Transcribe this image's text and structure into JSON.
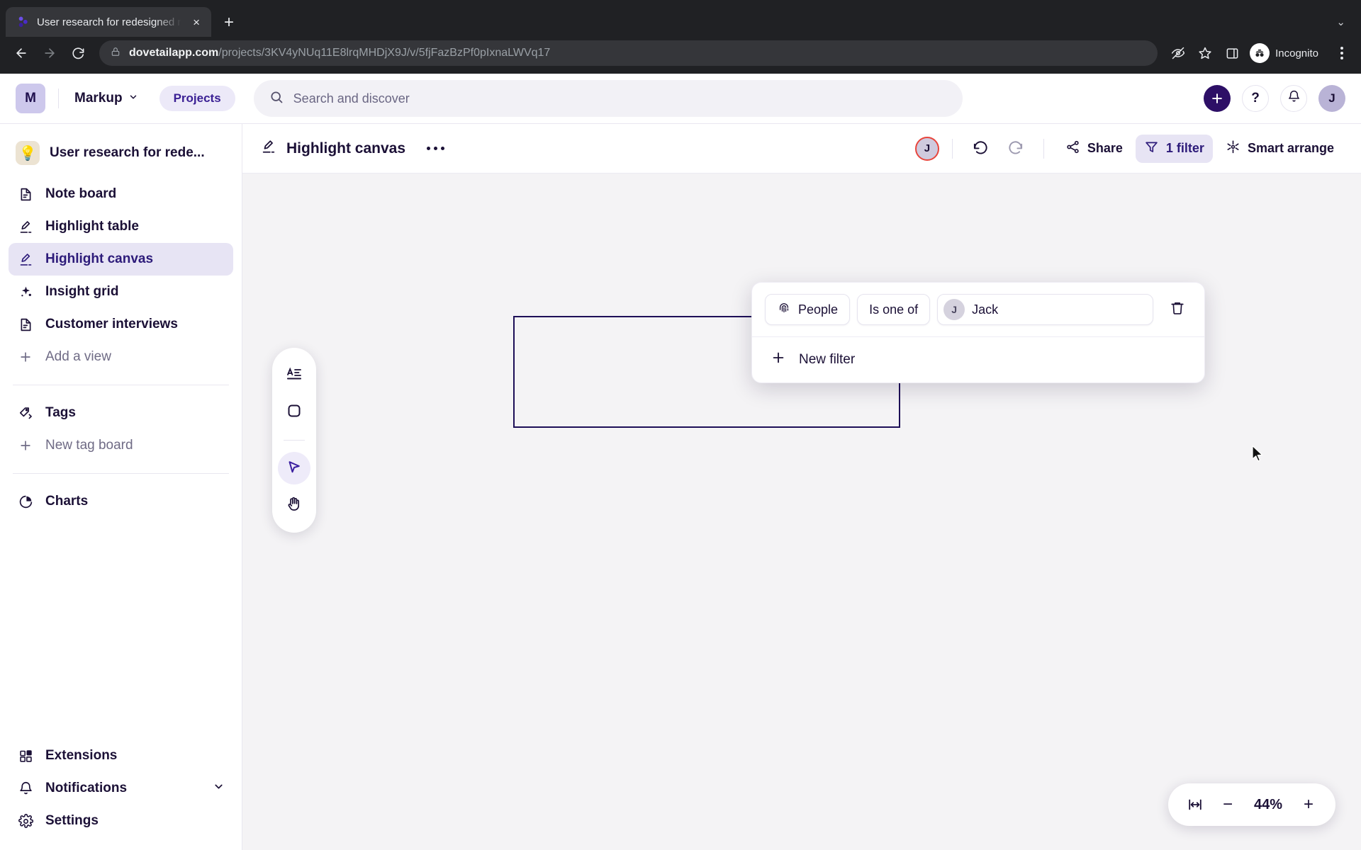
{
  "browser": {
    "tab": {
      "title": "User research for redesigned n",
      "favicon": "dovetail-logo-icon",
      "close": "×"
    },
    "new_tab_label": "+",
    "tab_list_chevron": "⌄",
    "back_icon": "back-arrow-icon",
    "forward_icon": "forward-arrow-icon",
    "reload_icon": "reload-icon",
    "url_domain": "dovetailapp.com",
    "url_path": "/projects/3KV4yNUq11E8lrqMHDjX9J/v/5fjFazBzPf0pIxnaLWVq17",
    "lock_icon": "lock-icon",
    "eye_off_icon": "eye-off-icon",
    "bookmark_icon": "star-icon",
    "side_panel_icon": "side-panel-icon",
    "incognito_label": "Incognito",
    "incognito_icon": "incognito-glasses-icon",
    "menu_icon": "three-dot-menu-icon"
  },
  "appbar": {
    "workspace_initial": "M",
    "workspace_name": "Markup",
    "workspace_chevron": "⌄",
    "projects_label": "Projects",
    "search_placeholder": "Search and discover",
    "search_value": "",
    "search_icon": "search-icon",
    "plus_label": "+",
    "help_label": "?",
    "bell_icon": "bell-icon",
    "avatar_initial": "J"
  },
  "sidebar": {
    "project": {
      "emoji": "💡",
      "name": "User research for rede..."
    },
    "views": [
      {
        "label": "Note board",
        "icon": "document-icon",
        "active": false
      },
      {
        "label": "Highlight table",
        "icon": "highlighter-icon",
        "active": false
      },
      {
        "label": "Highlight canvas",
        "icon": "highlighter-icon",
        "active": true
      },
      {
        "label": "Insight grid",
        "icon": "sparkle-icon",
        "active": false
      },
      {
        "label": "Customer interviews",
        "icon": "document-icon",
        "active": false
      }
    ],
    "add_view": {
      "label": "Add a view",
      "icon": "plus-icon"
    },
    "tags": {
      "label": "Tags",
      "icon": "tag-icon"
    },
    "new_tag_board": {
      "label": "New tag board",
      "icon": "plus-icon"
    },
    "charts": {
      "label": "Charts",
      "icon": "pie-chart-icon"
    },
    "extensions": {
      "label": "Extensions",
      "icon": "extensions-icon"
    },
    "notifications": {
      "label": "Notifications",
      "icon": "bell-icon",
      "chevron": "⌄"
    },
    "settings": {
      "label": "Settings",
      "icon": "gear-icon"
    }
  },
  "view_header": {
    "title": "Highlight canvas",
    "title_icon": "highlighter-icon",
    "more_icon": "more-options-icon",
    "presence_avatar": "J",
    "undo_icon": "undo-icon",
    "redo_icon": "redo-icon",
    "share_label": "Share",
    "share_icon": "share-icon",
    "filter_label": "1 filter",
    "filter_icon": "filter-funnel-icon",
    "smart_arrange_label": "Smart arrange",
    "smart_arrange_icon": "sparkle-wand-icon"
  },
  "filter_popover": {
    "field_label": "People",
    "field_icon": "fingerprint-icon",
    "operator_label": "Is one of",
    "value_avatar": "J",
    "value_label": "Jack",
    "delete_icon": "trash-icon",
    "new_filter_label": "New filter",
    "new_filter_icon": "plus-icon"
  },
  "canvas_toolbar": {
    "tools": [
      {
        "name": "text-annotation-tool",
        "icon": "text-align-icon",
        "active": false
      },
      {
        "name": "shape-tool",
        "icon": "rounded-square-icon",
        "active": false
      },
      {
        "name": "select-tool",
        "icon": "cursor-arrow-icon",
        "active": true
      },
      {
        "name": "pan-tool",
        "icon": "hand-icon",
        "active": false
      }
    ]
  },
  "zoom_control": {
    "fit_icon": "fit-to-width-icon",
    "minus_label": "−",
    "value": "44%",
    "plus_label": "+"
  },
  "colors": {
    "accent": "#2d0f66",
    "active_bg": "#e7e4f4",
    "active_text": "#2d1b7a",
    "canvas_bg": "#f4f3f5",
    "shape_stroke": "#1d0f57",
    "presence_ring": "#e8453c"
  }
}
